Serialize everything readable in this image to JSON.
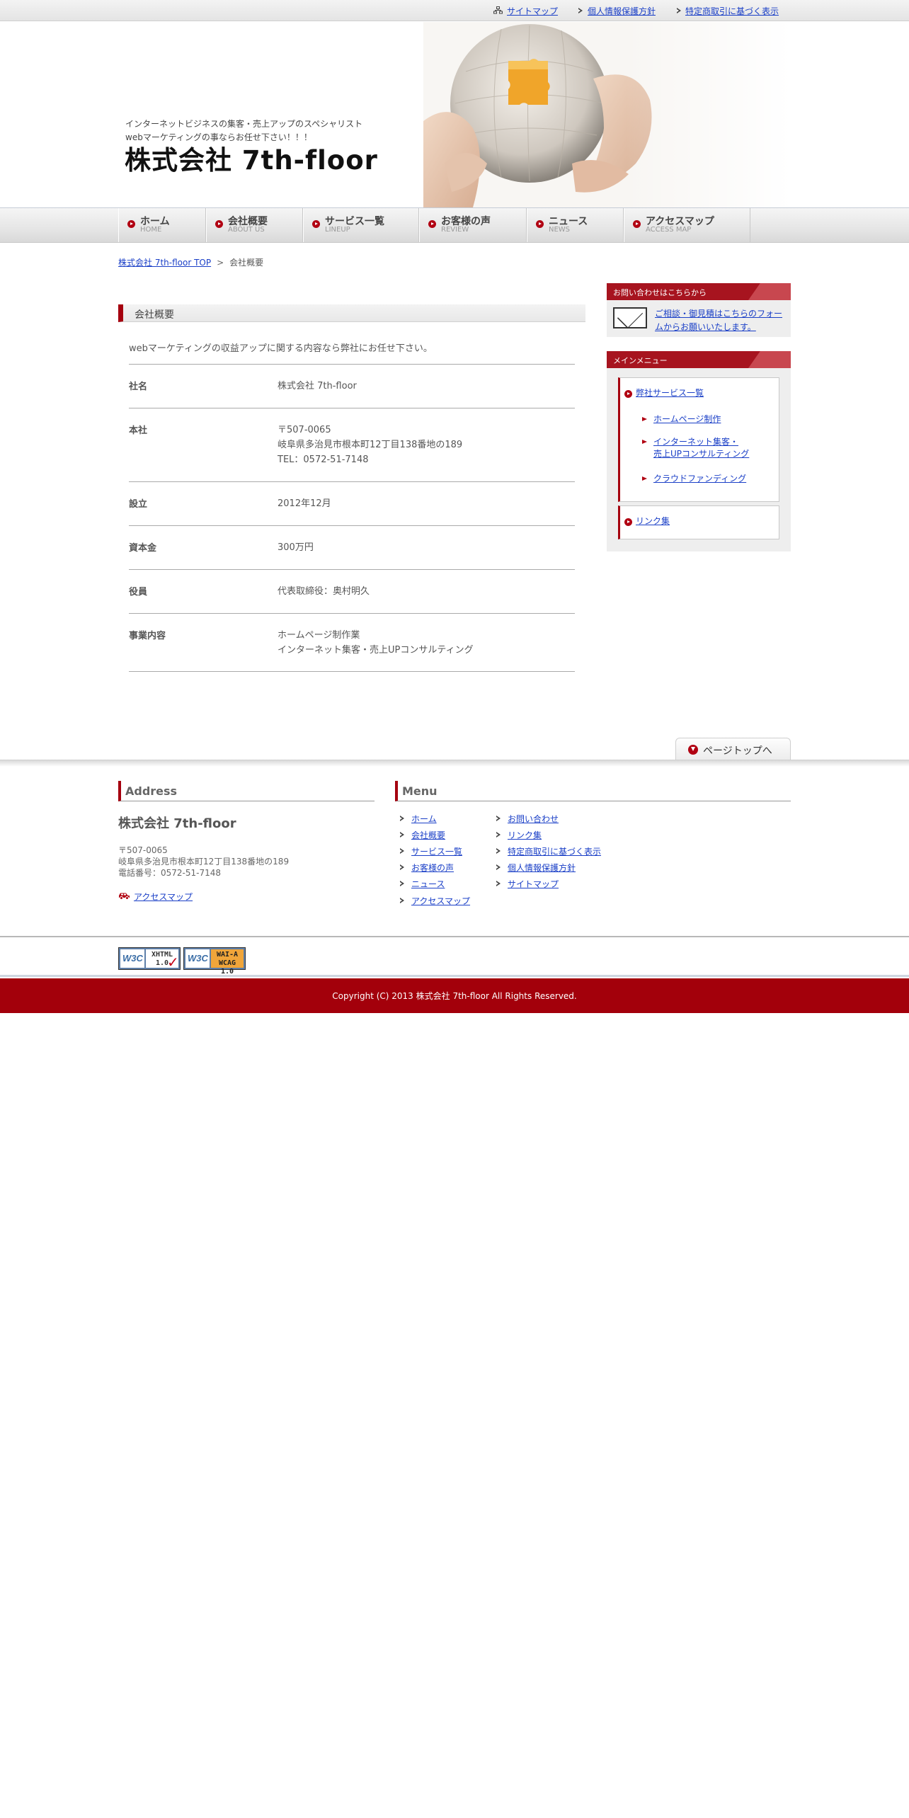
{
  "util_links": {
    "sitemap": "サイトマップ",
    "privacy": "個人情報保護方針",
    "tokutei": "特定商取引に基づく表示"
  },
  "header": {
    "catch_1": "インターネットビジネスの集客・売上アップのスペシャリスト",
    "catch_2": "webマーケティングの事ならお任せ下さい！！！",
    "logo": "株式会社 7th-floor"
  },
  "gnav": [
    {
      "jp": "ホーム",
      "en": "HOME"
    },
    {
      "jp": "会社概要",
      "en": "ABOUT US"
    },
    {
      "jp": "サービス一覧",
      "en": "LINEUP"
    },
    {
      "jp": "お客様の声",
      "en": "REVIEW"
    },
    {
      "jp": "ニュース",
      "en": "NEWS"
    },
    {
      "jp": "アクセスマップ",
      "en": "ACCESS MAP"
    }
  ],
  "breadcrumb": {
    "top": "株式会社 7th-floor TOP",
    "sep": ">",
    "current": "会社概要"
  },
  "main": {
    "title": "会社概要",
    "lead": "webマーケティングの収益アップに関する内容なら弊社にお任せ下さい。",
    "rows": [
      {
        "th": "社名",
        "td": [
          "株式会社 7th-floor"
        ]
      },
      {
        "th": "本社",
        "td": [
          "〒507-0065",
          "岐阜県多治見市根本町12丁目138番地の189",
          "TEL：0572-51-7148"
        ]
      },
      {
        "th": "設立",
        "td": [
          "2012年12月"
        ]
      },
      {
        "th": "資本金",
        "td": [
          "300万円"
        ]
      },
      {
        "th": "役員",
        "td": [
          "代表取締役：奥村明久"
        ]
      },
      {
        "th": "事業内容",
        "td": [
          "ホームページ制作業",
          "インターネット集客・売上UPコンサルティング"
        ]
      }
    ]
  },
  "sidebar": {
    "contact_heading": "お問い合わせはこちらから",
    "contact_text": "ご相談・御見積はこちらのフォームからお願いいたします。",
    "menu_heading": "メインメニュー",
    "service_link": "弊社サービス一覧",
    "sub_links": [
      "ホームページ制作",
      "インターネット集客・",
      "売上UPコンサルティング",
      "クラウドファンディング"
    ],
    "links_link": "リンク集"
  },
  "pagetop": "ページトップへ",
  "footer": {
    "address_heading": "Address",
    "menu_heading": "Menu",
    "company": "株式会社 7th-floor",
    "addr_1": "〒507-0065",
    "addr_2": "岐阜県多治見市根本町12丁目138番地の189",
    "addr_3": "電話番号：0572-51-7148",
    "access_link": "アクセスマップ",
    "menu_col1": [
      "ホーム",
      "会社概要",
      "サービス一覧",
      "お客様の声",
      "ニュース",
      "アクセスマップ"
    ],
    "menu_col2": [
      "お問い合わせ",
      "リンク集",
      "特定商取引に基づく表示",
      "個人情報保護方針",
      "サイトマップ"
    ]
  },
  "badges": {
    "xhtml_w3c": "W3C",
    "xhtml_text_1": "XHTML",
    "xhtml_text_2": "1.0",
    "wai_w3c": "W3C",
    "wai_text_1": "WAI-A",
    "wai_text_2": "WCAG 1.0"
  },
  "copyright": "Copyright (C) 2013 株式会社 7th-floor All Rights Reserved.",
  "colors": {
    "accent": "#a5000f",
    "link": "#1a3fc7",
    "footer_bg": "#a3000b"
  }
}
